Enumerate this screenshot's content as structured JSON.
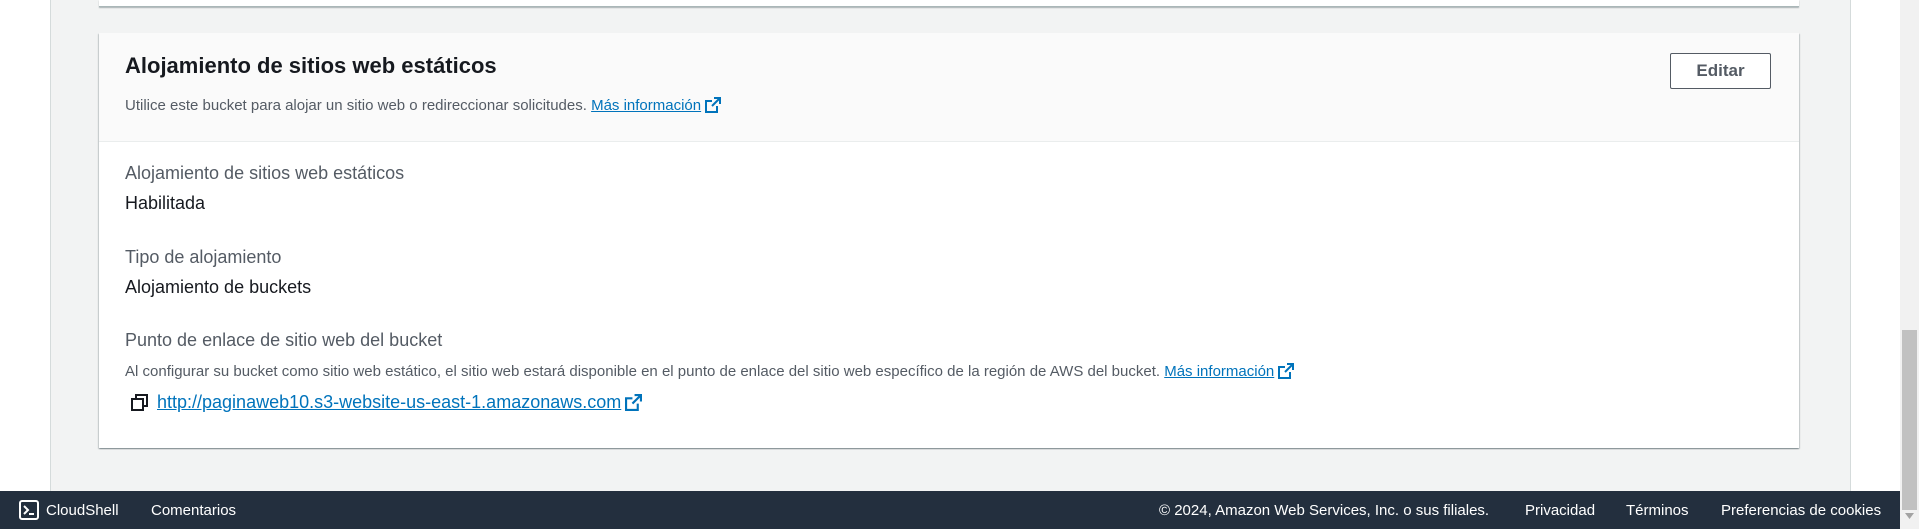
{
  "panel": {
    "title": "Alojamiento de sitios web estáticos",
    "description": "Utilice este bucket para alojar un sitio web o redireccionar solicitudes.",
    "learn_more": "Más información",
    "edit_label": "Editar"
  },
  "fields": {
    "hosting_label": "Alojamiento de sitios web estáticos",
    "hosting_value": "Habilitada",
    "type_label": "Tipo de alojamiento",
    "type_value": "Alojamiento de buckets",
    "endpoint_label": "Punto de enlace de sitio web del bucket",
    "endpoint_desc": "Al configurar su bucket como sitio web estático, el sitio web estará disponible en el punto de enlace del sitio web específico de la región de AWS del bucket.",
    "endpoint_learn_more": "Más información",
    "endpoint_url": "http://paginaweb10.s3-website-us-east-1.amazonaws.com"
  },
  "footer": {
    "cloudshell": "CloudShell",
    "comments": "Comentarios",
    "copyright": "© 2024, Amazon Web Services, Inc. o sus filiales.",
    "privacy": "Privacidad",
    "terms": "Términos",
    "cookies": "Preferencias de cookies"
  },
  "icons": {
    "external": "external-link-icon",
    "copy": "copy-icon",
    "cloudshell": "cloudshell-icon"
  },
  "colors": {
    "link": "#0073bb",
    "footer_bg": "#232f3e",
    "page_bg": "#f2f3f3"
  }
}
